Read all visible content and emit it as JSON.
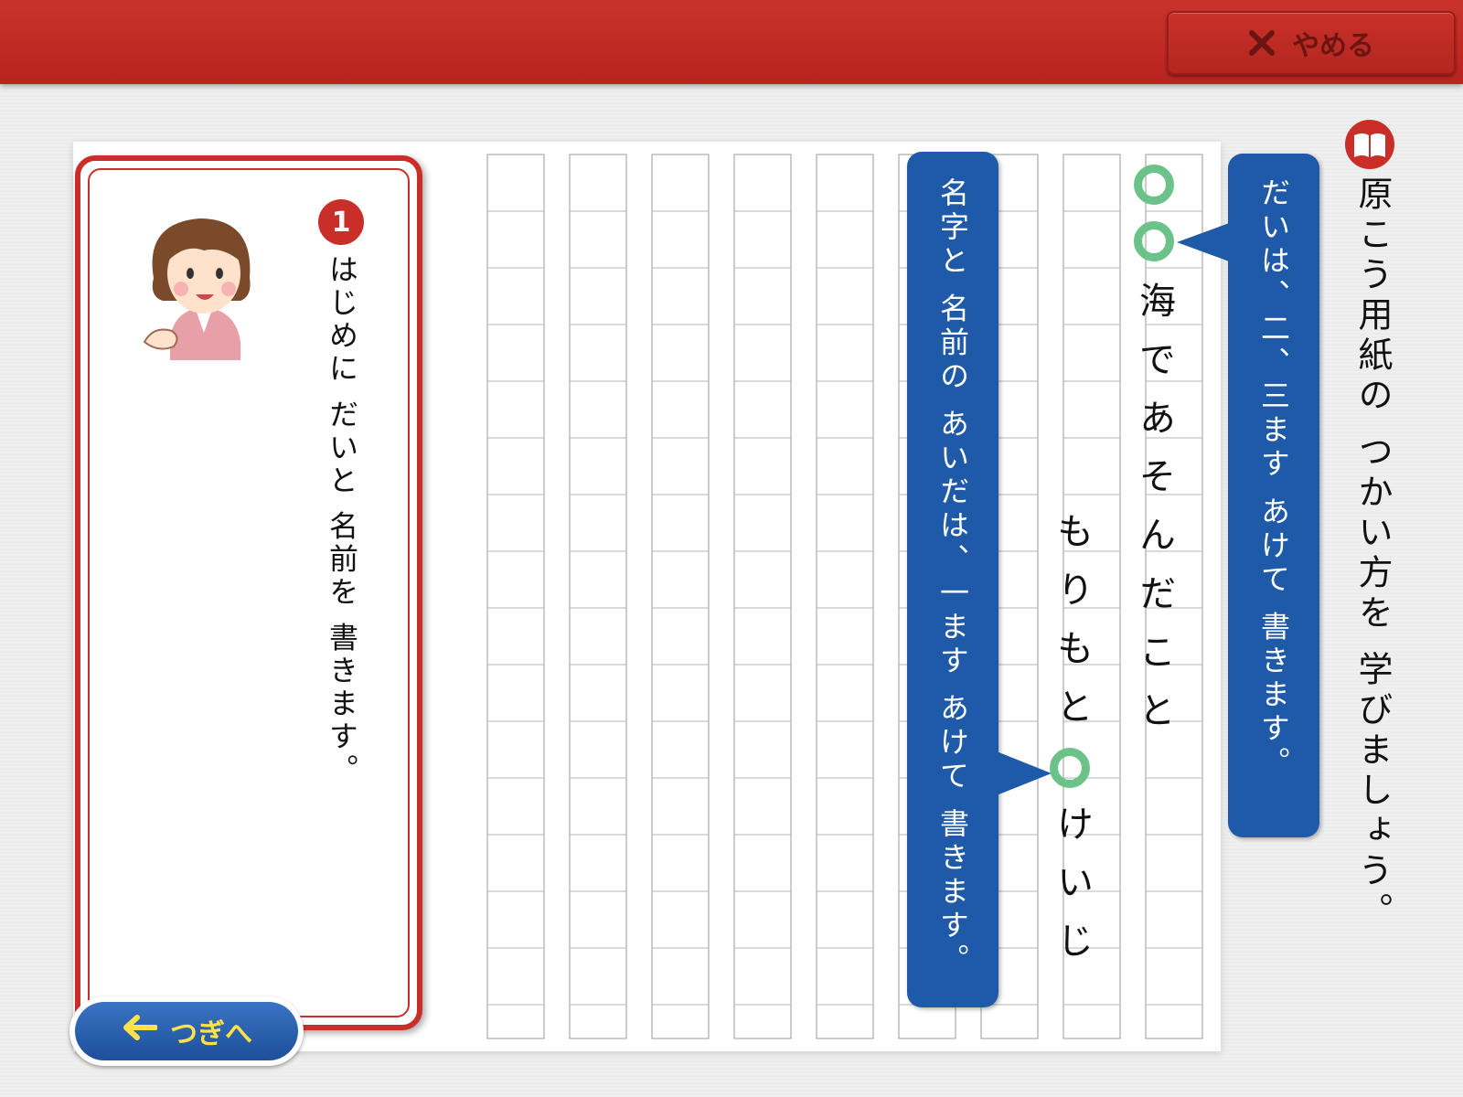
{
  "header": {
    "quit_label": "やめる",
    "icons": {
      "quit": "close-x-icon"
    }
  },
  "title": {
    "icon": "book-icon",
    "text": "原こう用紙の つかい方を 学びましょう。"
  },
  "tip_card": {
    "step_number": "1",
    "avatar": "teacher-avatar",
    "text": "はじめに だいと 名前を 書きます。"
  },
  "bubbles": [
    {
      "text": "だいは、二、三ます あけて 書きます。"
    },
    {
      "text": "名字と 名前の あいだは、一ます あけて 書きます。"
    }
  ],
  "manuscript": {
    "title_column": "海であそんだこと",
    "name_surname": "もりもと",
    "name_given": "けいじ"
  },
  "footer": {
    "next_label": "つぎへ",
    "icons": {
      "next": "arrow-left-icon"
    }
  },
  "colors": {
    "header_red": "#c0271f",
    "card_border": "#c92f28",
    "bubble_blue": "#1e5aa8",
    "ring_green": "#6cc389",
    "next_text": "#ffe24a"
  }
}
